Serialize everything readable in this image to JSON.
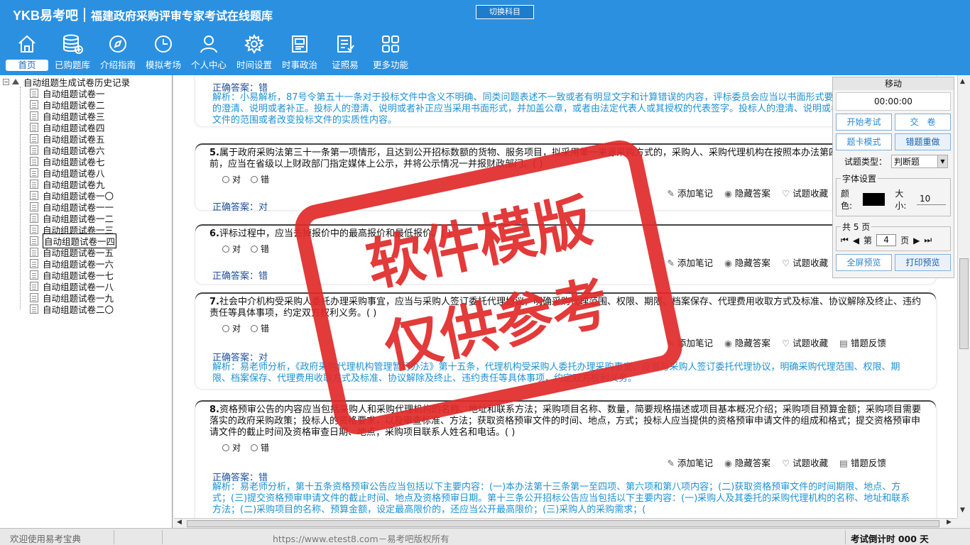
{
  "header": {
    "logo": "YKB易考吧",
    "title": "福建政府采购评审专家考试在线题库",
    "switch_label": "切换科目",
    "nav": [
      {
        "label": "首页",
        "icon": "home-icon"
      },
      {
        "label": "已购题库",
        "icon": "database-icon"
      },
      {
        "label": "介绍指南",
        "icon": "compass-icon"
      },
      {
        "label": "模拟考场",
        "icon": "clock-icon"
      },
      {
        "label": "个人中心",
        "icon": "user-icon"
      },
      {
        "label": "时间设置",
        "icon": "gear-icon"
      },
      {
        "label": "时事政治",
        "icon": "newspaper-icon"
      },
      {
        "label": "证照易",
        "icon": "checklist-icon"
      },
      {
        "label": "更多功能",
        "icon": "grid-icon"
      }
    ]
  },
  "tree": {
    "root_label": "自动组题生成试卷历史记录",
    "items": [
      "自动组题试卷一",
      "自动组题试卷二",
      "自动组题试卷三",
      "自动组题试卷四",
      "自动组题试卷五",
      "自动组题试卷六",
      "自动组题试卷七",
      "自动组题试卷八",
      "自动组题试卷九",
      "自动组题试卷一〇",
      "自动组题试卷一一",
      "自动组题试卷一二",
      "自动组题试卷一三",
      "自动组题试卷一四",
      "自动组题试卷一五",
      "自动组题试卷一六",
      "自动组题试卷一七",
      "自动组题试卷一八",
      "自动组题试卷一九",
      "自动组题试卷二〇"
    ],
    "selected_index": 13
  },
  "options": {
    "true": "对",
    "false": "错"
  },
  "tools": {
    "note": "添加笔记",
    "hide": "隐藏答案",
    "fav": "试题收藏",
    "report": "错题反馈"
  },
  "answer_prefix": "正确答案：",
  "questions": [
    {
      "answer": "错",
      "analysis": "解析：小易解析，87号令第五十一条对于投标文件中含义不明确、同类问题表述不一致或者有明显文字和计算错误的内容，评标委员会应当以书面形式要求投标人作出必要的澄清、说明或者补正。投标人的澄清、说明或者补正应当采用书面形式，并加盖公章，或者由法定代表人或其授权的代表签字。投标人的澄清、说明或者补正不得超出投标文件的范围或者改变投标文件的实质性内容。"
    },
    {
      "num": "5.",
      "text": "属于政府采购法第三十一条第一项情形，且达到公开招标数额的货物、服务项目，拟采用单一来源采购方式的，采购人、采购代理机构在按照本办法第四条报财政部门批准之前，应当在省级以上财政部门指定媒体上公示，并将公示情况一并报财政部门。( )",
      "answer": "对"
    },
    {
      "num": "6.",
      "text": "评标过程中，应当去掉报价中的最高报价和最低报价。( )",
      "answer": "错"
    },
    {
      "num": "7.",
      "text": "社会中介机构受采购人委托办理采购事宜，应当与采购人签订委托代理协议，明确采购代理范围、权限、期限、档案保存、代理费用收取方式及标准、协议解除及终止、违约责任等具体事项，约定双方权利义务。( )",
      "answer": "对",
      "analysis": "解析：易老师分析，《政府采购代理机构管理暂行办法》第十五条，代理机构受采购人委托办理采购事宜，应当与采购人签订委托代理协议，明确采购代理范围、权限、期限、档案保存、代理费用收取方式及标准、协议解除及终止、违约责任等具体事项，约定双方权利义务。"
    },
    {
      "num": "8.",
      "text": "资格预审公告的内容应当包括采购人和采购代理机构的名称、地址和联系方法；采购项目名称、数量，简要规格描述或项目基本概况介绍；采购项目预算金额；采购项目需要落实的政府采购政策；投标人的资格要求，以及审查标准、方法；获取资格预审文件的时间、地点，方式；投标人应当提供的资格预审申请文件的组成和格式；提交资格预审申请文件的截止时间及资格审查日期、地点；采购项目联系人姓名和电话。( )",
      "answer": "错",
      "analysis": "解析：易老师分析，第十五条资格预审公告应当包括以下主要内容：(一)本办法第十三条第一至四项、第六项和第八项内容；(二)获取资格预审文件的时间期限、地点、方式；(三)提交资格预审申请文件的截止时间、地点及资格预审日期。第十三条公开招标公告应当包括以下主要内容：(一)采购人及其委托的采购代理机构的名称、地址和联系方法；(二)采购项目的名称、预算金额，设定最高限价的，还应当公开最高限价；(三)采购人的采购需求；("
    }
  ],
  "panel": {
    "title": "移动",
    "timer": "00:00:00",
    "start_label": "开始考试",
    "submit_label": "交　卷",
    "card_label": "题卡模式",
    "redo_label": "错题重做",
    "type_label": "试题类型：",
    "type_value": "判断题",
    "font_legend": "字体设置",
    "color_label": "颜色:",
    "color_value": "#000000",
    "size_label": "大小:",
    "size_value": "10",
    "pages_legend": "共 5 页",
    "page_prefix": "第",
    "page_value": "4",
    "page_suffix": "页",
    "fullscreen_label": "全屏预览",
    "print_label": "打印预览"
  },
  "watermark": {
    "line1": "软件模版",
    "line2": "仅供参考"
  },
  "status": {
    "welcome": "欢迎使用易考宝典",
    "copyright": "https://www.etest8.com－易考吧版权所有",
    "countdown": "考试倒计时 000 天"
  }
}
